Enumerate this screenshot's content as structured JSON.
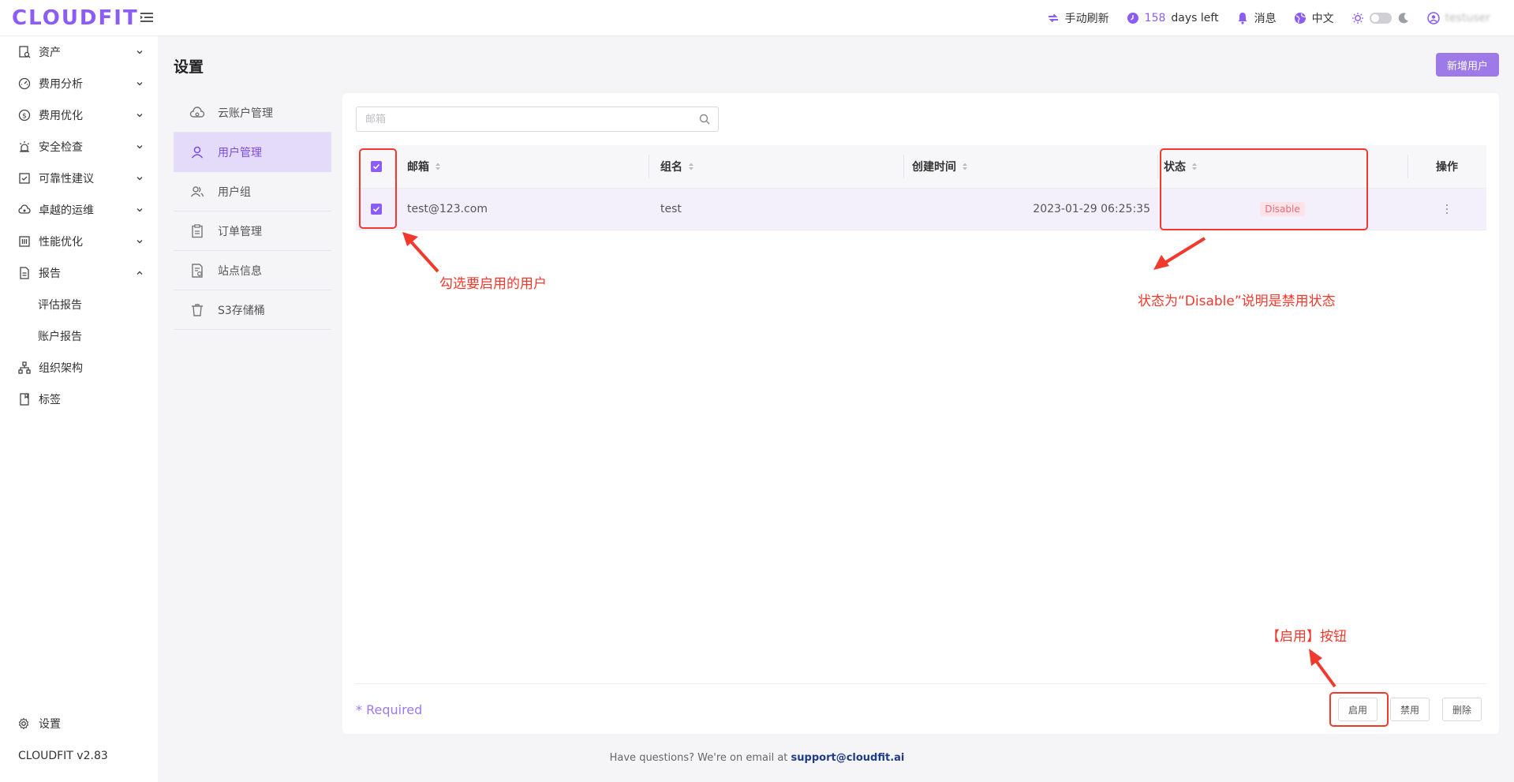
{
  "app": {
    "logo_text": "CLOUDFIT",
    "accent_color": "#8b5cf6",
    "version": "CLOUDFIT v2.83"
  },
  "topbar": {
    "refresh_label": "手动刷新",
    "days_number": "158",
    "days_suffix": "days left",
    "messages_label": "消息",
    "language_label": "中文",
    "user_name": "testuser"
  },
  "sidebar": {
    "items": [
      {
        "label": "资产",
        "icon": "asset-icon"
      },
      {
        "label": "费用分析",
        "icon": "cost-analysis-icon"
      },
      {
        "label": "费用优化",
        "icon": "dollar-icon"
      },
      {
        "label": "安全检查",
        "icon": "alarm-icon"
      },
      {
        "label": "可靠性建议",
        "icon": "reliability-icon"
      },
      {
        "label": "卓越的运维",
        "icon": "cloud-ops-icon"
      },
      {
        "label": "性能优化",
        "icon": "performance-icon"
      },
      {
        "label": "报告",
        "icon": "report-icon"
      },
      {
        "label": "评估报告"
      },
      {
        "label": "账户报告"
      },
      {
        "label": "组织架构",
        "icon": "org-icon"
      },
      {
        "label": "标签",
        "icon": "tag-icon"
      }
    ],
    "settings_label": "设置"
  },
  "page": {
    "title": "设置",
    "add_user_label": "新增用户"
  },
  "settings_menu": {
    "items": [
      {
        "label": "云账户管理"
      },
      {
        "label": "用户管理"
      },
      {
        "label": "用户组"
      },
      {
        "label": "订单管理"
      },
      {
        "label": "站点信息"
      },
      {
        "label": "S3存储桶"
      }
    ]
  },
  "search": {
    "placeholder": "邮箱"
  },
  "table": {
    "columns": {
      "email": "邮箱",
      "group": "组名",
      "created": "创建时间",
      "status": "状态",
      "actions": "操作"
    },
    "rows": [
      {
        "email": "test@123.com",
        "group": "test",
        "created": "2023-01-29 06:25:35",
        "status": "Disable"
      }
    ]
  },
  "footer": {
    "required": "* Required",
    "enable_label": "启用",
    "disable_label": "禁用",
    "delete_label": "删除"
  },
  "help": {
    "prefix": "Have questions? We're on email at ",
    "email": "support@cloudfit.ai"
  },
  "annotations": {
    "checkbox_note": "勾选要启用的用户",
    "status_note": "状态为“Disable”说明是禁用状态",
    "button_note": "【启用】按钮",
    "color": "#f03a2e"
  }
}
